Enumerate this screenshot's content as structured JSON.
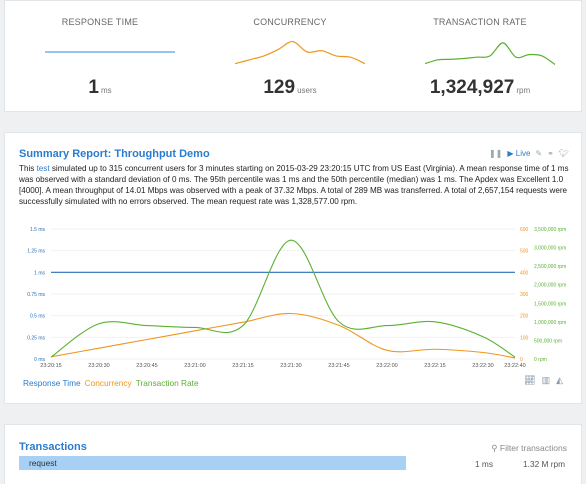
{
  "stats": [
    {
      "label": "RESPONSE TIME",
      "value": "1",
      "unit": "ms",
      "spark": [
        0.5,
        0.5,
        0.5,
        0.5,
        0.5,
        0.5
      ]
    },
    {
      "label": "CONCURRENCY",
      "value": "129",
      "unit": "users",
      "spark": [
        0.05,
        0.2,
        0.35,
        0.6,
        0.9,
        0.5,
        0.55,
        0.35,
        0.3,
        0.05
      ]
    },
    {
      "label": "TRANSACTION RATE",
      "value": "1,324,927",
      "unit": "rpm",
      "spark": [
        0.05,
        0.2,
        0.22,
        0.25,
        0.3,
        0.35,
        0.85,
        0.3,
        0.4,
        0.35,
        0.02
      ]
    }
  ],
  "report": {
    "title": "Summary Report: Throughput Demo",
    "live": "Live",
    "desc_pre": "This ",
    "desc_link": "test",
    "desc_post": " simulated up to 315 concurrent users for 3 minutes starting on 2015-03-29 23:20:15 UTC from US East (Virginia). A mean response time of 1 ms was observed with a standard deviation of 0 ms. The 95th percentile was 1 ms and the 50th percentile (median) was 1 ms. The Apdex was Excellent 1.0 [4000]. A mean throughput of 14.01 Mbps was observed with a peak of 37.32 Mbps. A total of 289 MB was transferred. A total of 2,657,154 requests were successfully simulated with no errors observed. The mean request rate was 1,328,577.00 rpm.",
    "legend": [
      "Response Time",
      "Concurrency",
      "Transaction Rate"
    ]
  },
  "chart_data": {
    "type": "line",
    "x": [
      "23:20:15",
      "23:20:30",
      "23:20:45",
      "23:21:00",
      "23:21:15",
      "23:21:30",
      "23:21:45",
      "23:22:00",
      "23:22:15",
      "23:22:30",
      "23:22:40"
    ],
    "x_numeric": [
      0,
      15,
      30,
      45,
      60,
      75,
      90,
      105,
      120,
      135,
      145
    ],
    "left_axis": {
      "ticks": [
        "1.5 ms",
        "1.25 ms",
        "1 ms",
        "0.75 ms",
        "0.5 ms",
        "0.25 ms",
        "0 ms"
      ],
      "range": [
        0,
        1.5
      ]
    },
    "right_axis": {
      "conc_ticks": [
        "600",
        "500",
        "400",
        "300",
        "200",
        "100",
        "0"
      ],
      "rate_ticks": [
        "3,500,000 rpm",
        "3,000,000 rpm",
        "2,500,000 rpm",
        "2,000,000 rpm",
        "1,500,000 rpm",
        "1,000,000 rpm",
        "500,000 rpm",
        "0 rpm"
      ]
    },
    "series": [
      {
        "name": "Response Time",
        "color": "#2b6fb5",
        "axis": "ms",
        "values": [
          1,
          1,
          1,
          1,
          1,
          1,
          1,
          1,
          1,
          1,
          1
        ]
      },
      {
        "name": "Concurrency",
        "color": "#f0951e",
        "axis": "users",
        "values": [
          10,
          50,
          90,
          130,
          170,
          210,
          155,
          40,
          45,
          30,
          5
        ]
      },
      {
        "name": "Transaction Rate",
        "color": "#5ab033",
        "axis": "rpm",
        "values": [
          50000,
          950000,
          900000,
          850000,
          900000,
          3200000,
          1000000,
          900000,
          1000000,
          600000,
          50000
        ]
      }
    ]
  },
  "transactions": {
    "title": "Transactions",
    "filter": "Filter transactions",
    "rows": [
      {
        "name": "request",
        "time": "1 ms",
        "rate": "1.32 M rpm"
      }
    ]
  }
}
